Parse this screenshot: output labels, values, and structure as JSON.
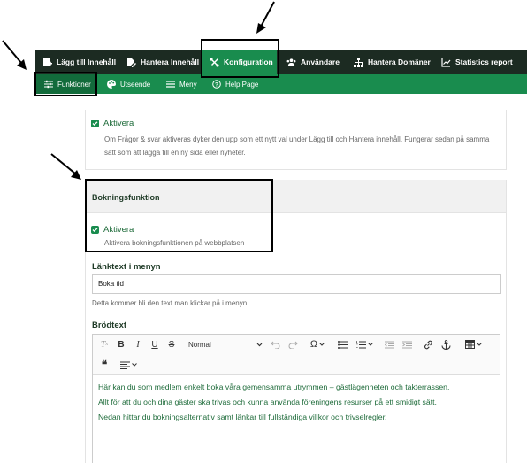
{
  "topnav": {
    "items": [
      {
        "label": "Lägg till Innehåll",
        "icon": "add-content-icon"
      },
      {
        "label": "Hantera Innehåll",
        "icon": "edit-document-icon"
      },
      {
        "label": "Konfiguration",
        "icon": "tools-icon"
      },
      {
        "label": "Användare",
        "icon": "users-icon"
      },
      {
        "label": "Hantera Domäner",
        "icon": "sitemap-icon"
      },
      {
        "label": "Statistics report",
        "icon": "chart-icon"
      }
    ]
  },
  "subnav": {
    "items": [
      {
        "label": "Funktioner",
        "icon": "sliders-icon"
      },
      {
        "label": "Utseende",
        "icon": "palette-icon"
      },
      {
        "label": "Meny",
        "icon": "menu-icon"
      },
      {
        "label": "Help Page",
        "icon": "help-icon"
      }
    ]
  },
  "qa_panel": {
    "checkbox_label": "Aktivera",
    "description": "Om Frågor & svar aktiveras dyker den upp som ett nytt val under Lägg till och Hantera innehåll. Fungerar sedan på samma sätt som att lägga till en ny sida eller nyheter."
  },
  "booking_panel": {
    "title": "Bokningsfunktion",
    "checkbox_label": "Aktivera",
    "checkbox_description": "Aktivera bokningsfunktionen på webbplatsen",
    "menu_text_label": "Länktext i menyn",
    "menu_text_value": "Boka tid",
    "menu_text_help": "Detta kommer bli den text man klickar på i menyn.",
    "body_label": "Brödtext"
  },
  "editor": {
    "format_value": "Normal",
    "lines": [
      "Här kan du som medlem enkelt boka våra gemensamma utrymmen – gästlägenheten och takterrassen.",
      "Allt för att du och dina gäster ska trivas och kunna använda föreningens resurser på ett smidigt sätt.",
      "Nedan hittar du bokningsalternativ samt länkar till fullständiga villkor och trivselregler."
    ]
  },
  "colors": {
    "topnav_bg": "#1c2b22",
    "accent_green": "#198c4e",
    "text_green": "#1e6b3a"
  }
}
